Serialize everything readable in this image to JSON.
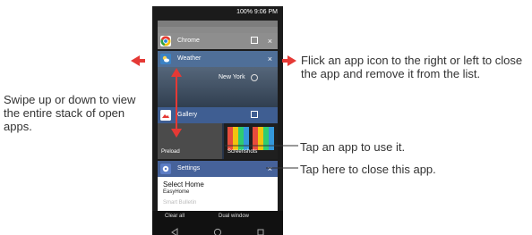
{
  "status_bar": {
    "text": "100% 9:06 PM"
  },
  "cards": {
    "chrome": {
      "title": "Chrome",
      "close": "×"
    },
    "weather": {
      "title": "Weather",
      "city": "New York",
      "close": "×"
    },
    "gallery": {
      "title": "Gallery",
      "left_label": "Preload",
      "right_label": "Screenshots"
    },
    "settings": {
      "title": "Settings",
      "close": "×",
      "line1": "Select Home",
      "line2": "EasyHome",
      "line3": "Smart Bulletin"
    }
  },
  "bottom": {
    "clear_all": "Clear all",
    "dual_window": "Dual window"
  },
  "annotations": {
    "left": "Swipe up or down to view the entire stack of open apps.",
    "right": "Flick an app icon to the right or left to close the app and remove it from the list.",
    "tap_app": "Tap an app to use it.",
    "tap_close": "Tap here to close this app."
  },
  "colors": {
    "header_gray": "#8e8e8e",
    "weather_blue": "#4f6f98",
    "gallery_blue": "#3f5e92",
    "settings_blue": "#46629a",
    "arrow_red": "#e53935",
    "chrome_green": "#2ea043",
    "chrome_red": "#e53935",
    "chrome_yellow": "#f4c20d"
  },
  "icons": [
    "chrome-icon",
    "weather-icon",
    "gallery-icon",
    "settings-gear-icon",
    "close-icon",
    "split-window-icon",
    "back-icon",
    "home-icon",
    "recent-apps-icon",
    "double-headed-arrow-icon",
    "left-arrow-icon",
    "right-arrow-icon",
    "status-battery-icon"
  ]
}
